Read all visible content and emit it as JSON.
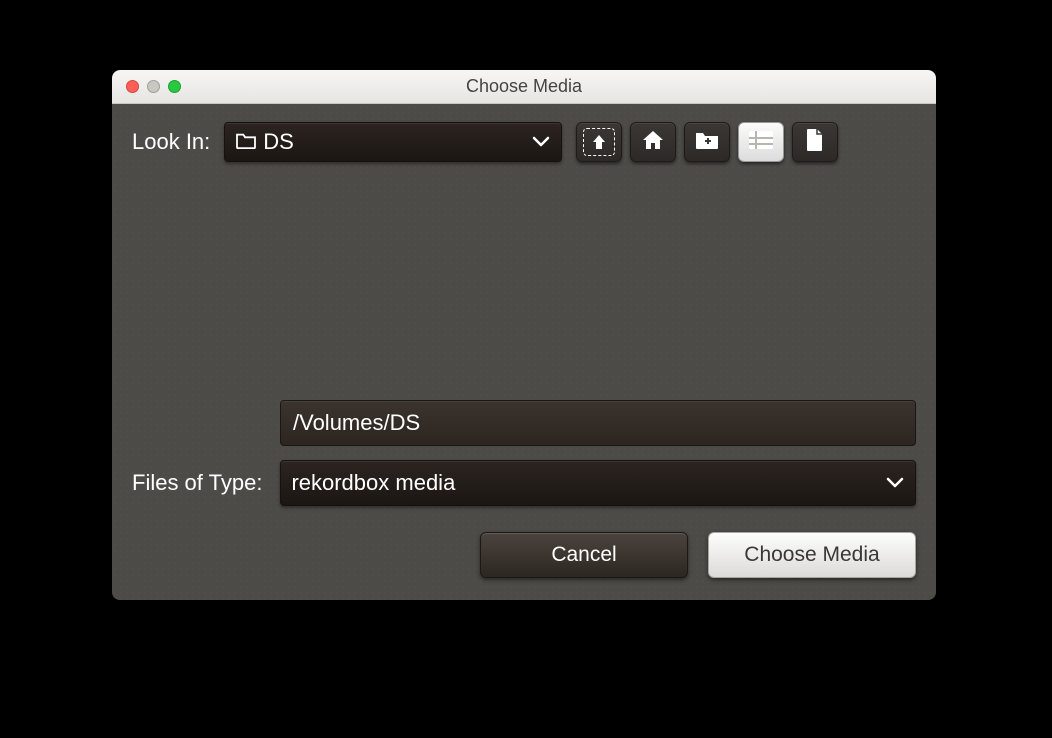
{
  "window": {
    "title": "Choose Media"
  },
  "lookin": {
    "label": "Look In:",
    "value": "DS"
  },
  "path": {
    "value": "/Volumes/DS"
  },
  "filetype": {
    "label": "Files of Type:",
    "value": "rekordbox media"
  },
  "buttons": {
    "cancel": "Cancel",
    "choose": "Choose Media"
  },
  "icons": {
    "folder": "folder-icon",
    "chev": "chevron-down-icon",
    "up": "arrow-up-icon",
    "home": "home-icon",
    "newfolder": "new-folder-icon",
    "list": "list-view-icon",
    "details": "document-icon"
  }
}
